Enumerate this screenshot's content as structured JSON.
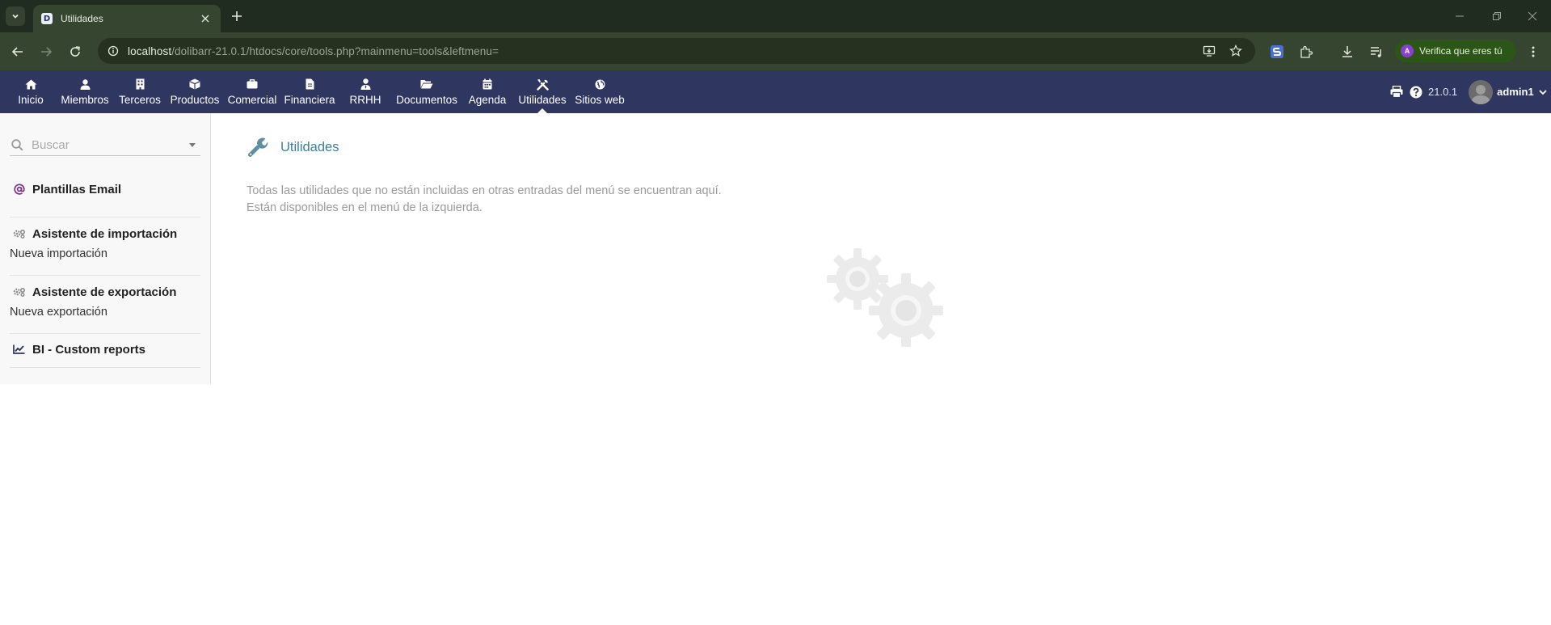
{
  "browser": {
    "tab_title": "Utilidades",
    "url_host": "localhost",
    "url_path": "/dolibarr-21.0.1/htdocs/core/tools.php?mainmenu=tools&leftmenu=",
    "profile_initial": "A",
    "verify_label": "Verifica que eres tú"
  },
  "topmenu": {
    "items": [
      {
        "label": "Inicio",
        "icon": "home-icon"
      },
      {
        "label": "Miembros",
        "icon": "user-icon"
      },
      {
        "label": "Terceros",
        "icon": "building-icon"
      },
      {
        "label": "Productos",
        "icon": "cube-icon"
      },
      {
        "label": "Comercial",
        "icon": "briefcase-icon"
      },
      {
        "label": "Financiera",
        "icon": "invoice-icon"
      },
      {
        "label": "RRHH",
        "icon": "user-tie-icon"
      },
      {
        "label": "Documentos",
        "icon": "folder-open-icon"
      },
      {
        "label": "Agenda",
        "icon": "calendar-icon"
      },
      {
        "label": "Utilidades",
        "icon": "tools-icon",
        "active": true
      },
      {
        "label": "Sitios web",
        "icon": "globe-icon"
      }
    ],
    "version": "21.0.1",
    "username": "admin1"
  },
  "leftmenu": {
    "search_placeholder": "Buscar",
    "sections": [
      {
        "title": "Plantillas Email",
        "icon": "at-icon"
      },
      {
        "title": "Asistente de importación",
        "icon": "cogs-icon",
        "sub": "Nueva importación"
      },
      {
        "title": "Asistente de exportación",
        "icon": "cogs-icon",
        "sub": "Nueva exportación"
      },
      {
        "title": "BI - Custom reports",
        "icon": "chart-line-icon"
      }
    ]
  },
  "main": {
    "title": "Utilidades",
    "description_line1": "Todas las utilidades que no están incluidas en otras entradas del menú se encuentran aquí.",
    "description_line2": "Están disponibles en el menú de la izquierda."
  },
  "colors": {
    "topmenu_bg": "#2f365f",
    "title_color": "#3d7f98",
    "browser_frame": "#202c1f"
  }
}
